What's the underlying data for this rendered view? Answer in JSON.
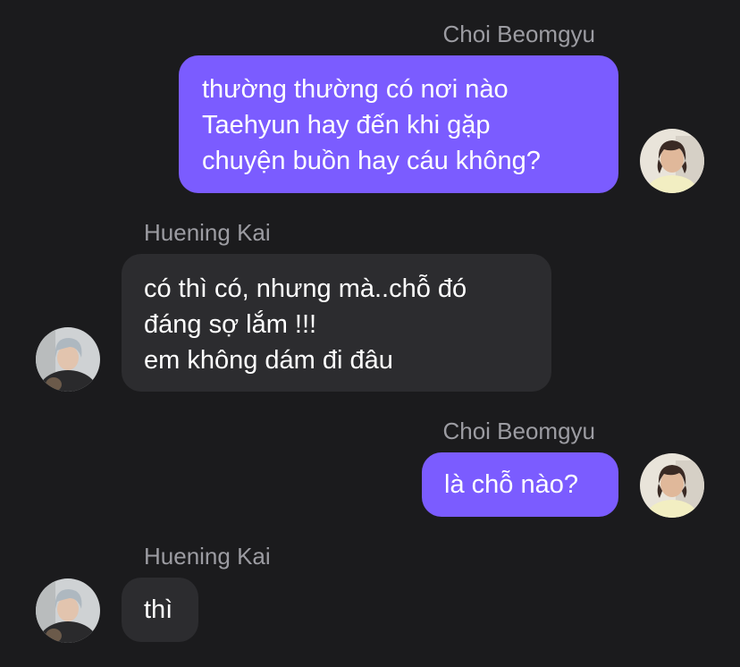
{
  "messages": [
    {
      "sender": "Choi Beomgyu",
      "direction": "outgoing",
      "avatar": "avatar-beomgyu",
      "lines": [
        "thường thường có nơi nào",
        "Taehyun hay đến khi gặp",
        "chuyện buồn hay cáu không?"
      ]
    },
    {
      "sender": "Huening Kai",
      "direction": "incoming",
      "avatar": "avatar-hueningkai",
      "lines": [
        "có thì có, nhưng mà..chỗ đó",
        "đáng sợ lắm !!!",
        "em không dám đi đâu"
      ]
    },
    {
      "sender": "Choi Beomgyu",
      "direction": "outgoing",
      "avatar": "avatar-beomgyu",
      "lines": [
        "là chỗ nào?"
      ]
    },
    {
      "sender": "Huening Kai",
      "direction": "incoming",
      "avatar": "avatar-hueningkai",
      "lines": [
        "thì"
      ]
    }
  ],
  "colors": {
    "background": "#1b1b1d",
    "outgoing_bubble": "#7b5cff",
    "incoming_bubble": "#2c2c2f",
    "sender_name": "#9c9ca2",
    "text": "#ffffff"
  }
}
